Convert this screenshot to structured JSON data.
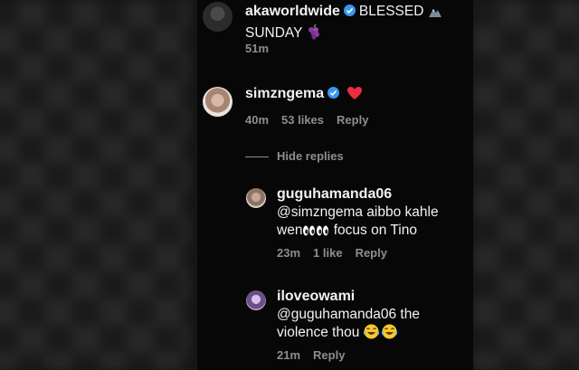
{
  "comments": {
    "c1": {
      "username": "akaworldwide",
      "text_line1": "BLESSED",
      "text_line2": "SUNDAY",
      "time": "51m"
    },
    "c2": {
      "username": "simzngema",
      "time": "40m",
      "likes": "53 likes",
      "reply": "Reply"
    },
    "hide_replies": "Hide replies",
    "r1": {
      "username": "guguhamanda06",
      "text_line1": "@simzngema aibbo kahle",
      "text_line2a": "wen",
      "text_line2b": "focus on Tino",
      "time": "23m",
      "likes": "1 like",
      "reply": "Reply"
    },
    "r2": {
      "username": "iloveowami",
      "text_line1": "@guguhamanda06 the",
      "text_line2": "violence thou",
      "time": "21m",
      "reply": "Reply"
    }
  },
  "colors": {
    "panel_bg": "#070707",
    "meta_gray": "#8e8e8e",
    "verified_blue": "#3897f0",
    "heart_red": "#ed2d44"
  },
  "icons": [
    "mountain-emoji-icon",
    "grapes-emoji-icon",
    "verified-badge-icon",
    "red-heart-emoji-icon",
    "eyes-emoji-icon",
    "laughing-emoji-icon"
  ]
}
